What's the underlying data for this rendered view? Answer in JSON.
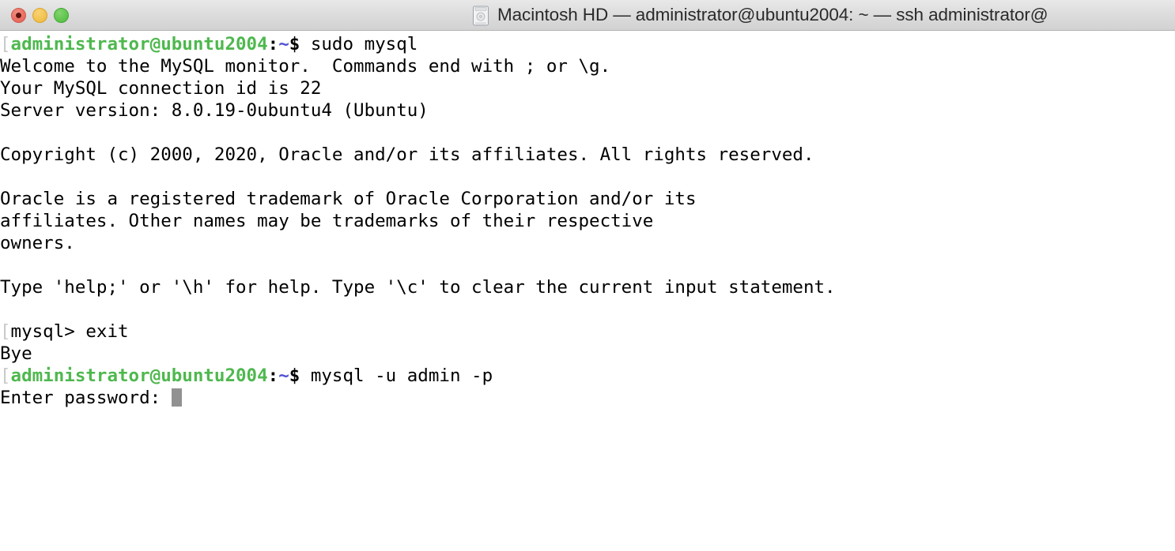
{
  "window": {
    "titlebar": {
      "title": "Macintosh HD — administrator@ubuntu2004: ~ — ssh administrator@",
      "disk_icon": "hard-disk-icon",
      "buttons": {
        "close": "close-button",
        "minimize": "minimize-button",
        "zoom": "zoom-button"
      }
    }
  },
  "colors": {
    "titlebar_bg": "#dcdcdc",
    "terminal_bg": "#ffffff",
    "terminal_fg": "#000000",
    "prompt_green": "#4eb84e",
    "prompt_blue": "#4f4fd4",
    "cursor_gray": "#919191",
    "close_red": "#ec7063",
    "minimize_yellow": "#f2c44f",
    "zoom_green": "#63c650"
  },
  "terminal": {
    "lines": [
      {
        "type": "prompt",
        "bracket": "[",
        "host": "administrator@ubuntu2004",
        "colon": ":",
        "tilde": "~",
        "dollar": "$",
        "command": " sudo mysql"
      },
      {
        "type": "text",
        "text": "Welcome to the MySQL monitor.  Commands end with ; or \\g."
      },
      {
        "type": "text",
        "text": "Your MySQL connection id is 22"
      },
      {
        "type": "text",
        "text": "Server version: 8.0.19-0ubuntu4 (Ubuntu)"
      },
      {
        "type": "blank",
        "text": ""
      },
      {
        "type": "text",
        "text": "Copyright (c) 2000, 2020, Oracle and/or its affiliates. All rights reserved."
      },
      {
        "type": "blank",
        "text": ""
      },
      {
        "type": "text",
        "text": "Oracle is a registered trademark of Oracle Corporation and/or its"
      },
      {
        "type": "text",
        "text": "affiliates. Other names may be trademarks of their respective"
      },
      {
        "type": "text",
        "text": "owners."
      },
      {
        "type": "blank",
        "text": ""
      },
      {
        "type": "text",
        "text": "Type 'help;' or '\\h' for help. Type '\\c' to clear the current input statement."
      },
      {
        "type": "blank",
        "text": ""
      },
      {
        "type": "mysql",
        "bracket": "[",
        "text": "mysql> exit"
      },
      {
        "type": "text",
        "text": "Bye"
      },
      {
        "type": "prompt",
        "bracket": "[",
        "host": "administrator@ubuntu2004",
        "colon": ":",
        "tilde": "~",
        "dollar": "$",
        "command": " mysql -u admin -p"
      },
      {
        "type": "password",
        "text": "Enter password: "
      }
    ]
  }
}
